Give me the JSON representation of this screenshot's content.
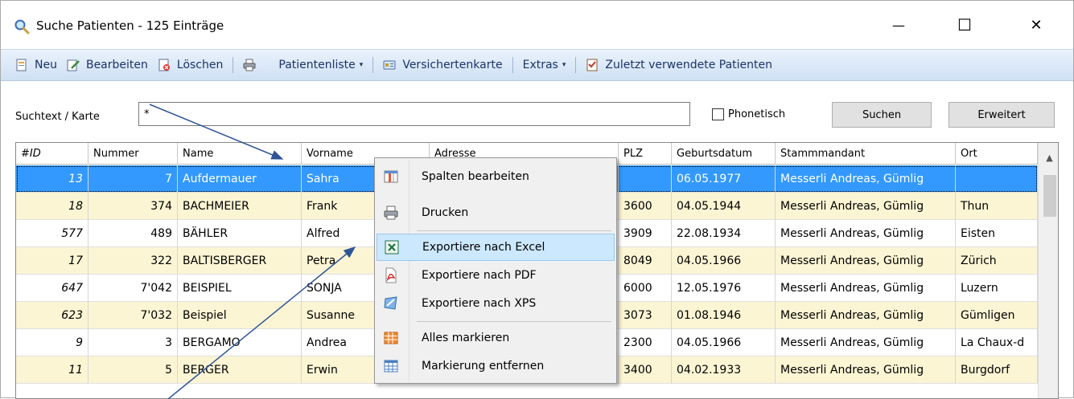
{
  "window": {
    "title": "Suche Patienten - 125 Einträge",
    "icon": "search-icon",
    "minimize_glyph": "—",
    "maximize_glyph": "☐",
    "close_glyph": "✕"
  },
  "toolbar": {
    "new_label": "Neu",
    "edit_label": "Bearbeiten",
    "delete_label": "Löschen",
    "print_icon": "printer-icon",
    "patientlist_label": "Patientenliste",
    "insurancecard_label": "Versichertenkarte",
    "extras_label": "Extras",
    "recent_label": "Zuletzt verwendete Patienten",
    "caret": "▾"
  },
  "search": {
    "label": "Suchtext / Karte",
    "value": "*",
    "phonetic_label": "Phonetisch",
    "phonetic_checked": false,
    "search_button": "Suchen",
    "advanced_button": "Erweitert"
  },
  "grid": {
    "columns": [
      "#ID",
      "Nummer",
      "Name",
      "Vorname",
      "Adresse",
      "PLZ",
      "Geburtsdatum",
      "Stammmandant",
      "Ort"
    ],
    "rows": [
      {
        "id": "13",
        "nummer": "7",
        "name": "Aufdermauer",
        "vorname": "Sahra",
        "plz": "",
        "geburt": "06.05.1977",
        "mandant": "Messerli Andreas, Gümlig",
        "ort": ""
      },
      {
        "id": "18",
        "nummer": "374",
        "name": "BACHMEIER",
        "vorname": "Frank",
        "plz": "3600",
        "geburt": "04.05.1944",
        "mandant": "Messerli Andreas, Gümlig",
        "ort": "Thun"
      },
      {
        "id": "577",
        "nummer": "489",
        "name": "BÄHLER",
        "vorname": "Alfred",
        "plz": "3909",
        "geburt": "22.08.1934",
        "mandant": "Messerli Andreas, Gümlig",
        "ort": "Eisten"
      },
      {
        "id": "17",
        "nummer": "322",
        "name": "BALTISBERGER",
        "vorname": "Petra",
        "plz": "8049",
        "geburt": "04.05.1966",
        "mandant": "Messerli Andreas, Gümlig",
        "ort": "Zürich"
      },
      {
        "id": "647",
        "nummer": "7'042",
        "name": "BEISPIEL",
        "vorname": "SONJA",
        "plz": "6000",
        "geburt": "12.05.1976",
        "mandant": "Messerli Andreas, Gümlig",
        "ort": "Luzern"
      },
      {
        "id": "623",
        "nummer": "7'032",
        "name": "Beispiel",
        "vorname": "Susanne",
        "plz": "3073",
        "geburt": "01.08.1946",
        "mandant": "Messerli Andreas, Gümlig",
        "ort": "Gümligen"
      },
      {
        "id": "9",
        "nummer": "3",
        "name": "BERGAMO",
        "vorname": "Andrea",
        "plz": "2300",
        "geburt": "04.05.1966",
        "mandant": "Messerli Andreas, Gümlig",
        "ort": "La Chaux-d"
      },
      {
        "id": "11",
        "nummer": "5",
        "name": "BERGER",
        "vorname": "Erwin",
        "plz": "3400",
        "geburt": "04.02.1933",
        "mandant": "Messerli Andreas, Gümlig",
        "ort": "Burgdorf"
      }
    ],
    "selected_row": 0
  },
  "context_menu": {
    "items": [
      {
        "label": "Spalten bearbeiten",
        "icon": "columns-icon"
      },
      {
        "label": "Drucken",
        "icon": "printer-icon"
      },
      {
        "label": "Exportiere nach Excel",
        "icon": "excel-icon"
      },
      {
        "label": "Exportiere nach PDF",
        "icon": "pdf-icon"
      },
      {
        "label": "Exportiere nach XPS",
        "icon": "xps-icon"
      },
      {
        "label": "Alles markieren",
        "icon": "select-all-icon"
      },
      {
        "label": "Markierung entfernen",
        "icon": "deselect-icon"
      }
    ],
    "highlighted_index": 2
  },
  "colors": {
    "selection": "#3399ff",
    "alt_row": "#fbf5d4",
    "toolbar_text": "#1a3466",
    "menu_highlight": "#cce8ff",
    "annotation_arrow": "#2f5597"
  }
}
